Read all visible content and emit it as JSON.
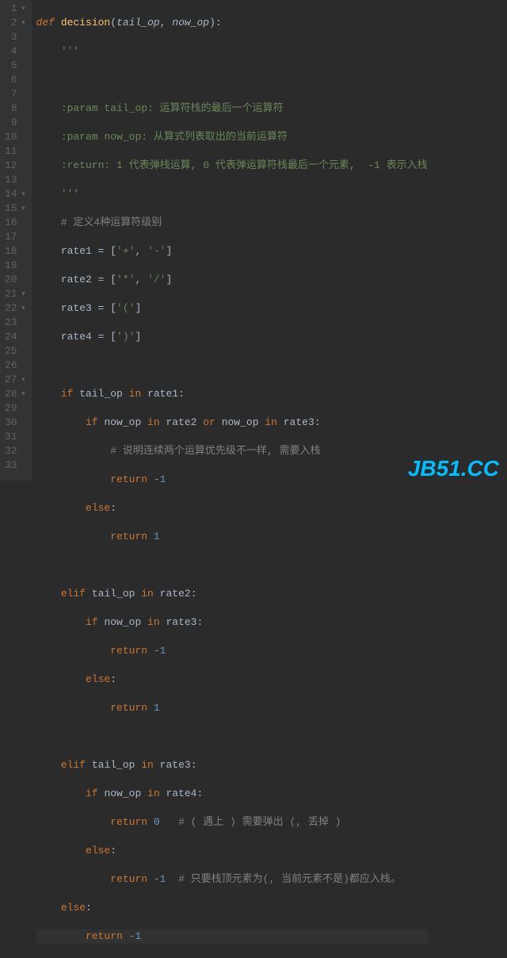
{
  "watermark": "JB51.CC",
  "gutter": [
    {
      "n": "1",
      "f": "▾"
    },
    {
      "n": "2",
      "f": "▾"
    },
    {
      "n": "3",
      "f": ""
    },
    {
      "n": "4",
      "f": ""
    },
    {
      "n": "5",
      "f": ""
    },
    {
      "n": "6",
      "f": ""
    },
    {
      "n": "7",
      "f": ""
    },
    {
      "n": "8",
      "f": ""
    },
    {
      "n": "9",
      "f": ""
    },
    {
      "n": "10",
      "f": ""
    },
    {
      "n": "11",
      "f": ""
    },
    {
      "n": "12",
      "f": ""
    },
    {
      "n": "13",
      "f": ""
    },
    {
      "n": "14",
      "f": "▾"
    },
    {
      "n": "15",
      "f": "▾"
    },
    {
      "n": "16",
      "f": ""
    },
    {
      "n": "17",
      "f": ""
    },
    {
      "n": "18",
      "f": ""
    },
    {
      "n": "19",
      "f": ""
    },
    {
      "n": "20",
      "f": ""
    },
    {
      "n": "21",
      "f": "▾"
    },
    {
      "n": "22",
      "f": "▾"
    },
    {
      "n": "23",
      "f": ""
    },
    {
      "n": "24",
      "f": ""
    },
    {
      "n": "25",
      "f": ""
    },
    {
      "n": "26",
      "f": ""
    },
    {
      "n": "27",
      "f": "▾"
    },
    {
      "n": "28",
      "f": "▾"
    },
    {
      "n": "29",
      "f": ""
    },
    {
      "n": "30",
      "f": ""
    },
    {
      "n": "31",
      "f": ""
    },
    {
      "n": "32",
      "f": ""
    },
    {
      "n": "33",
      "f": ""
    }
  ],
  "t": {
    "def": "def ",
    "decision": "decision",
    "lp": "(",
    "tail_op": "tail_op",
    "cm": ", ",
    "now_op": "now_op",
    "rp": ")",
    "colon": ":",
    "doc": "'''",
    "p1": ":param tail_op: 运算符栈的最后一个运算符",
    "p2": ":param now_op: 从算式列表取出的当前运算符",
    "p3": ":return: 1 代表弹栈运算, 0 代表弹运算符栈最后一个元素,  -1 表示入栈",
    "c1": "# 定义4种运算符级别",
    "r1a": "rate1 = [",
    "s_plus": "'+'",
    "s_minus": "'-'",
    "rb": "]",
    "r2a": "rate2 = [",
    "s_star": "'*'",
    "s_slash": "'/'",
    "r3a": "rate3 = [",
    "s_lp": "'('",
    "r4a": "rate4 = [",
    "s_rp": "')'",
    "if": "if ",
    "elif": "elif ",
    "else": "else",
    "in": " in ",
    "or": " or ",
    "rate1": "rate1",
    "rate2": "rate2",
    "rate3": "rate3",
    "rate4": "rate4",
    "c2": "# 说明连续两个运算优先级不一样, 需要入栈",
    "return": "return ",
    "neg1": "-1",
    "one": "1",
    "zero": "0",
    "c3": "# ( 遇上 ) 需要弹出 (, 丢掉 )",
    "c4": "# 只要栈顶元素为(, 当前元素不是)都应入栈。"
  }
}
